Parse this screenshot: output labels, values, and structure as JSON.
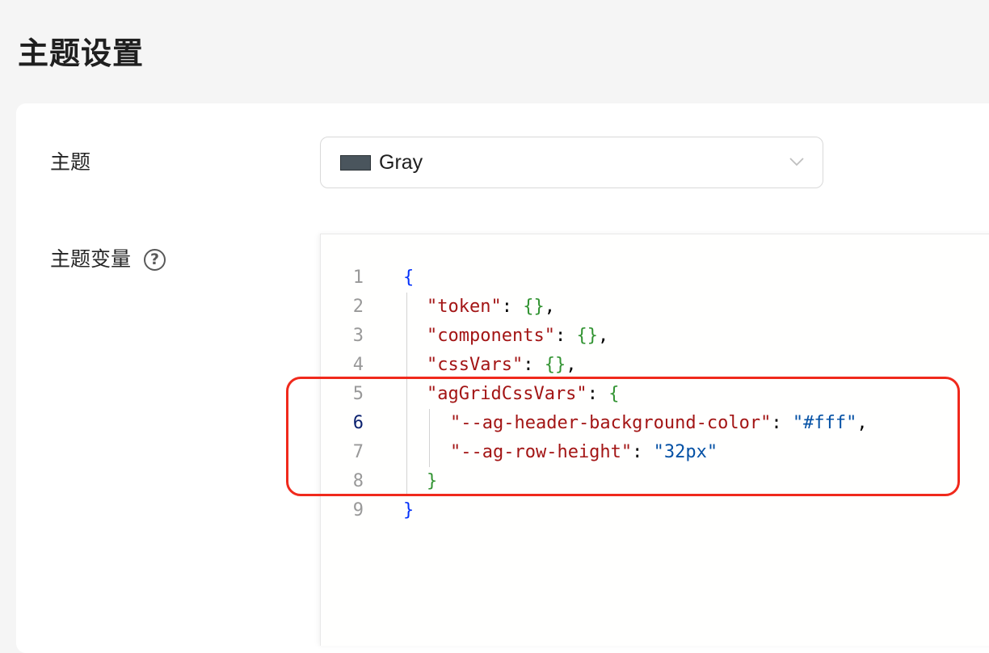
{
  "page": {
    "title": "主题设置"
  },
  "form": {
    "theme_label": "主题",
    "theme_select": {
      "value": "Gray",
      "swatch_color": "#4a555d"
    },
    "vars_label": "主题变量",
    "help_icon": "?"
  },
  "editor": {
    "lines": [
      {
        "no": "1",
        "parts": [
          {
            "t": "{",
            "c": "brace"
          }
        ]
      },
      {
        "no": "2",
        "parts": [
          {
            "t": "\"token\"",
            "c": "key"
          },
          {
            "t": ": ",
            "c": "punc"
          },
          {
            "t": "{}",
            "c": "obj"
          },
          {
            "t": ",",
            "c": "punc"
          }
        ]
      },
      {
        "no": "3",
        "parts": [
          {
            "t": "\"components\"",
            "c": "key"
          },
          {
            "t": ": ",
            "c": "punc"
          },
          {
            "t": "{}",
            "c": "obj"
          },
          {
            "t": ",",
            "c": "punc"
          }
        ]
      },
      {
        "no": "4",
        "parts": [
          {
            "t": "\"cssVars\"",
            "c": "key"
          },
          {
            "t": ": ",
            "c": "punc"
          },
          {
            "t": "{}",
            "c": "obj"
          },
          {
            "t": ",",
            "c": "punc"
          }
        ]
      },
      {
        "no": "5",
        "parts": [
          {
            "t": "\"agGridCssVars\"",
            "c": "key"
          },
          {
            "t": ": ",
            "c": "punc"
          },
          {
            "t": "{",
            "c": "obj"
          }
        ]
      },
      {
        "no": "6",
        "parts": [
          {
            "t": "\"--ag-header-background-color\"",
            "c": "key"
          },
          {
            "t": ": ",
            "c": "punc"
          },
          {
            "t": "\"#fff\"",
            "c": "str"
          },
          {
            "t": ",",
            "c": "punc"
          }
        ]
      },
      {
        "no": "7",
        "parts": [
          {
            "t": "\"--ag-row-height\"",
            "c": "key"
          },
          {
            "t": ": ",
            "c": "punc"
          },
          {
            "t": "\"32px\"",
            "c": "str"
          }
        ]
      },
      {
        "no": "8",
        "parts": [
          {
            "t": "}",
            "c": "obj"
          }
        ]
      },
      {
        "no": "9",
        "parts": [
          {
            "t": "}",
            "c": "brace"
          }
        ]
      }
    ],
    "active_line": "6"
  },
  "colors": {
    "highlight": "#f0291c",
    "key": "#a31515",
    "string": "#0451a5",
    "brace": "#0431fa",
    "nested_brace": "#319331"
  }
}
